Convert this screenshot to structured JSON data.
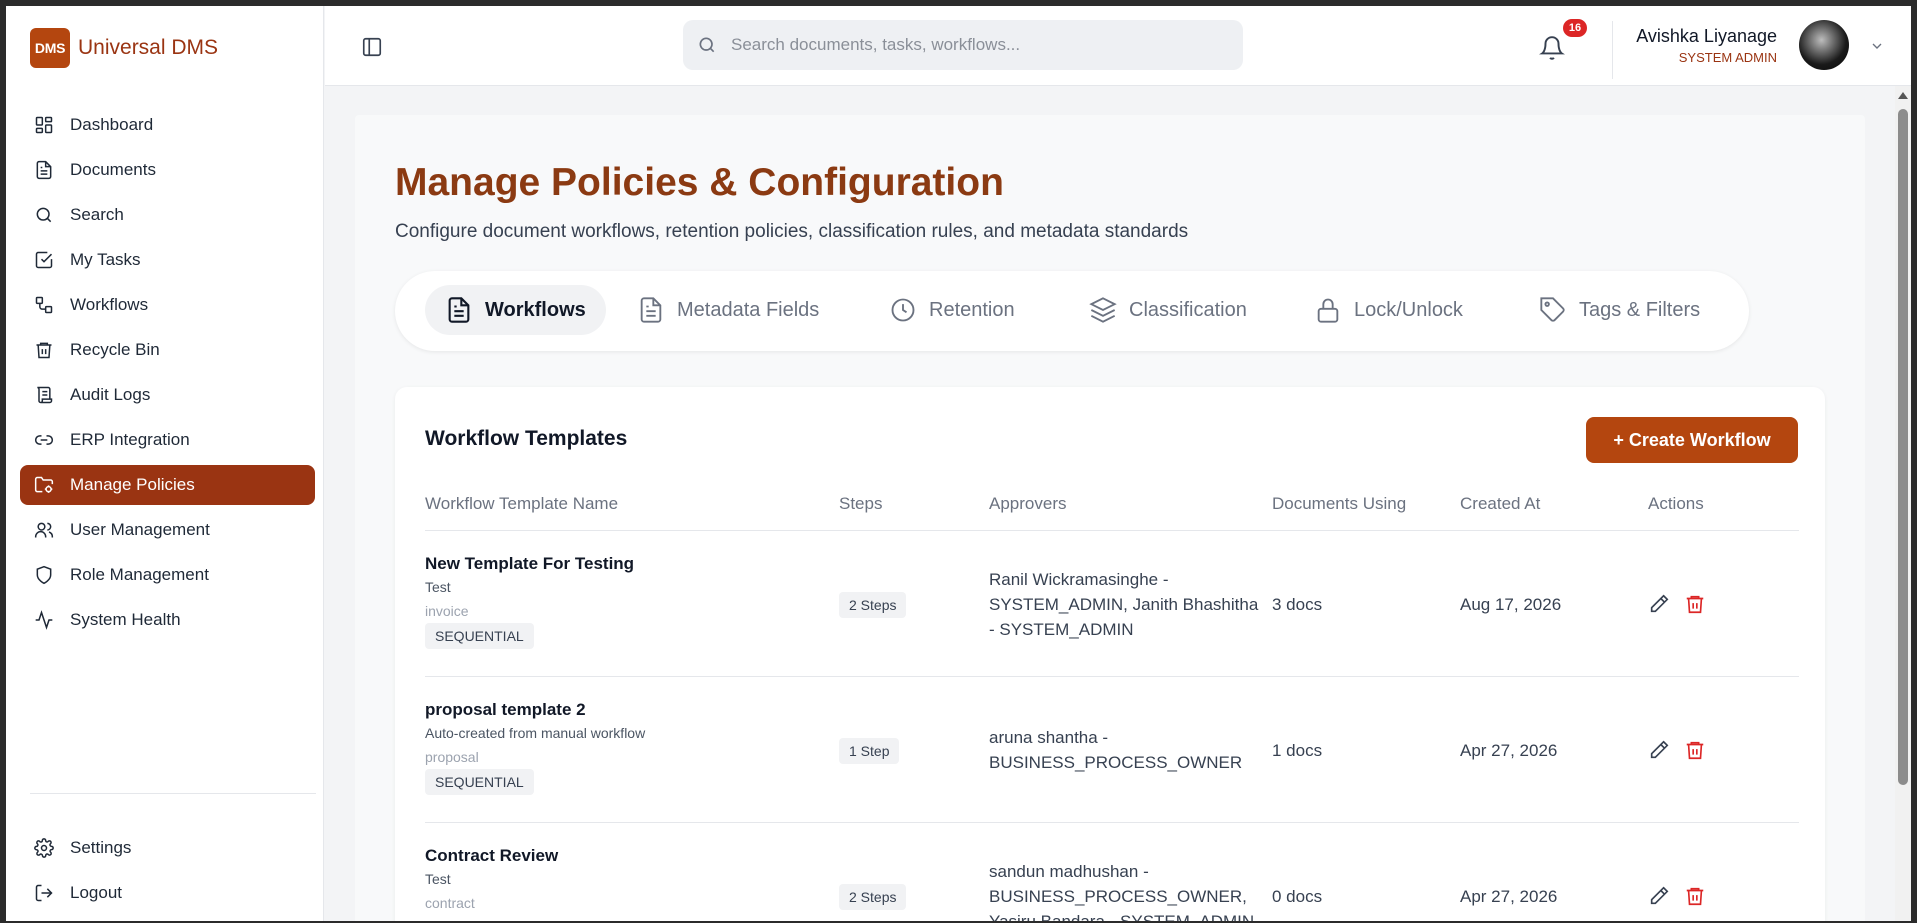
{
  "app": {
    "logo_text": "DMS",
    "name": "Universal DMS"
  },
  "sidebar": {
    "items": [
      {
        "label": "Dashboard",
        "icon": "dashboard-icon"
      },
      {
        "label": "Documents",
        "icon": "document-icon"
      },
      {
        "label": "Search",
        "icon": "search-icon"
      },
      {
        "label": "My Tasks",
        "icon": "checkbox-icon"
      },
      {
        "label": "Workflows",
        "icon": "workflow-icon"
      },
      {
        "label": "Recycle Bin",
        "icon": "trash-icon"
      },
      {
        "label": "Audit Logs",
        "icon": "scroll-icon"
      },
      {
        "label": "ERP Integration",
        "icon": "link-icon"
      },
      {
        "label": "Manage Policies",
        "icon": "folder-settings-icon",
        "active": true
      },
      {
        "label": "User Management",
        "icon": "users-icon"
      },
      {
        "label": "Role Management",
        "icon": "shield-icon"
      },
      {
        "label": "System Health",
        "icon": "activity-icon"
      }
    ],
    "bottom": [
      {
        "label": "Settings",
        "icon": "gear-icon"
      },
      {
        "label": "Logout",
        "icon": "logout-icon"
      }
    ]
  },
  "header": {
    "search_placeholder": "Search documents, tasks, workflows...",
    "notification_count": "16",
    "user_name": "Avishka Liyanage",
    "user_role": "SYSTEM ADMIN"
  },
  "page": {
    "title": "Manage Policies & Configuration",
    "subtitle": "Configure document workflows, retention policies, classification rules, and metadata standards"
  },
  "tabs": [
    {
      "label": "Workflows",
      "icon": "document-icon",
      "active": true
    },
    {
      "label": "Metadata Fields",
      "icon": "file-text-icon"
    },
    {
      "label": "Retention",
      "icon": "clock-icon"
    },
    {
      "label": "Classification",
      "icon": "layers-icon"
    },
    {
      "label": "Lock/Unlock",
      "icon": "lock-icon"
    },
    {
      "label": "Tags & Filters",
      "icon": "tag-icon"
    }
  ],
  "card": {
    "title": "Workflow Templates",
    "create_label": "+ Create Workflow"
  },
  "table": {
    "columns": [
      "Workflow Template Name",
      "Steps",
      "Approvers",
      "Documents Using",
      "Created At",
      "Actions"
    ],
    "rows": [
      {
        "name": "New Template For Testing",
        "description": "Test",
        "doc_type": "invoice",
        "mode": "SEQUENTIAL",
        "steps": "2 Steps",
        "approvers": "Ranil Wickramasinghe - SYSTEM_ADMIN, Janith Bhashitha - SYSTEM_ADMIN",
        "documents": "3 docs",
        "created": "Aug 17, 2026"
      },
      {
        "name": "proposal template 2",
        "description": "Auto-created from manual workflow",
        "doc_type": "proposal",
        "mode": "SEQUENTIAL",
        "steps": "1 Step",
        "approvers": "aruna shantha - BUSINESS_PROCESS_OWNER",
        "documents": "1 docs",
        "created": "Apr 27, 2026"
      },
      {
        "name": "Contract Review",
        "description": "Test",
        "doc_type": "contract",
        "mode": "",
        "steps": "2 Steps",
        "approvers": "sandun madhushan - BUSINESS_PROCESS_OWNER, Yasiru Bandara - SYSTEM_ADMIN",
        "documents": "0 docs",
        "created": "Apr 27, 2026"
      }
    ]
  },
  "colors": {
    "accent": "#9a3412",
    "accent_button": "#b4460f",
    "delete": "#dc2626",
    "badge": "#dc2626"
  }
}
